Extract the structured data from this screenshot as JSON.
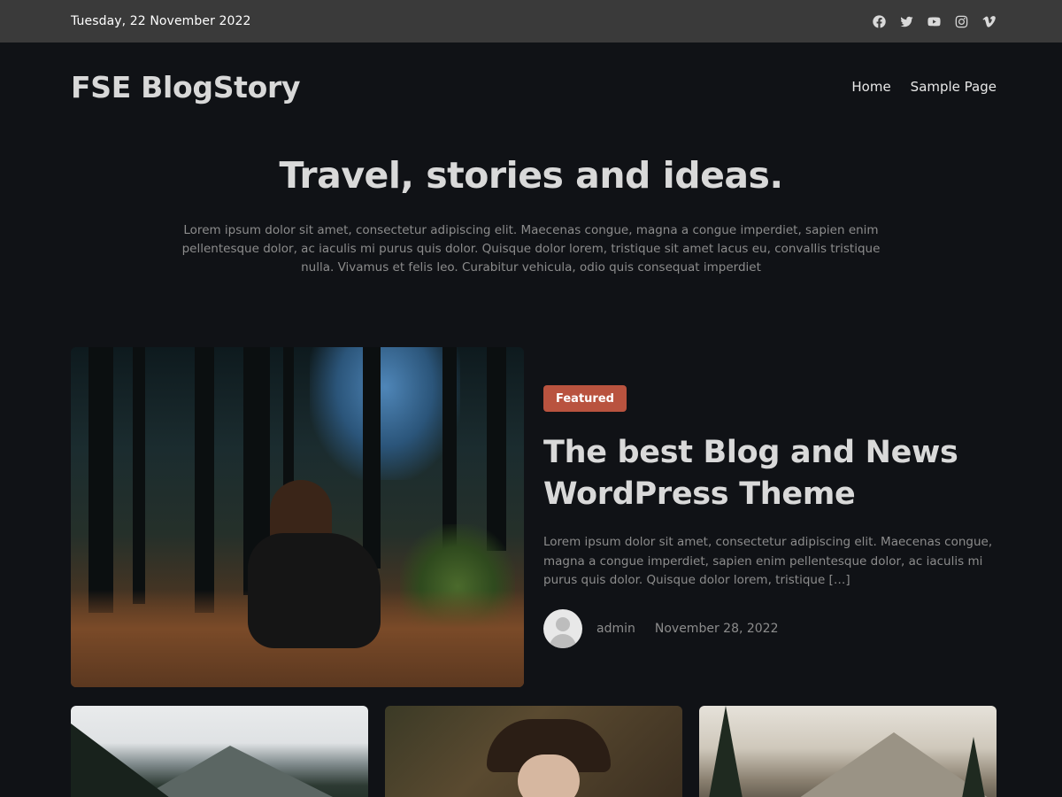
{
  "topbar": {
    "date": "Tuesday, 22 November 2022",
    "social": [
      {
        "icon": "facebook-icon"
      },
      {
        "icon": "twitter-icon"
      },
      {
        "icon": "youtube-icon"
      },
      {
        "icon": "instagram-icon"
      },
      {
        "icon": "vimeo-icon"
      }
    ]
  },
  "header": {
    "site_title": "FSE BlogStory",
    "nav": [
      {
        "label": "Home"
      },
      {
        "label": "Sample Page"
      }
    ]
  },
  "hero": {
    "title": "Travel, stories and ideas.",
    "text": "Lorem ipsum dolor sit amet, consectetur adipiscing elit. Maecenas congue, magna a congue imperdiet, sapien enim pellentesque dolor, ac iaculis mi purus quis dolor. Quisque dolor lorem, tristique sit amet lacus eu, convallis tristique nulla. Vivamus et felis leo. Curabitur vehicula, odio quis consequat imperdiet"
  },
  "featured_post": {
    "badge": "Featured",
    "title": "The best Blog and News WordPress Theme",
    "excerpt": "Lorem ipsum dolor sit amet, consectetur adipiscing elit. Maecenas congue, magna a congue imperdiet, sapien enim pellentesque dolor, ac iaculis mi purus quis dolor. Quisque dolor lorem, tristique […]",
    "author": "admin",
    "date": "November 28, 2022"
  },
  "colors": {
    "background": "#101216",
    "topbar": "#3a3a3a",
    "badge": "#b9533f",
    "muted_text": "#8c8c8c"
  }
}
